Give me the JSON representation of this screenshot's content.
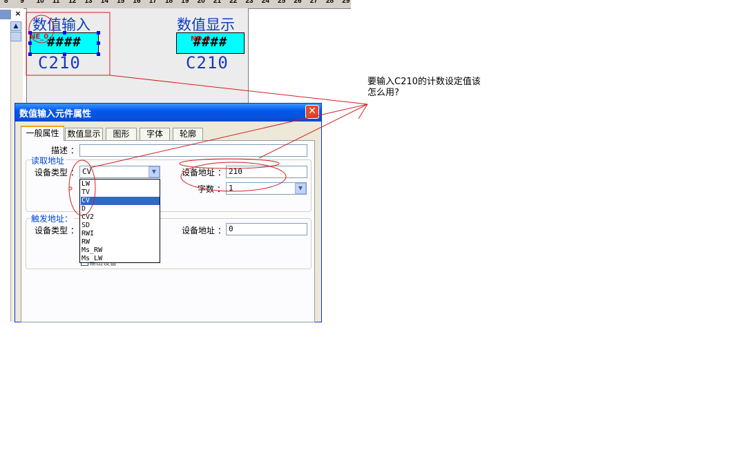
{
  "ruler": {
    "ticks": [
      "8",
      "9",
      "10",
      "11",
      "12",
      "13",
      "14",
      "15",
      "16",
      "17",
      "18",
      "19",
      "20",
      "21",
      "22",
      "23",
      "24",
      "25",
      "26",
      "27",
      "28",
      "29"
    ]
  },
  "panel": {
    "close_label": "×",
    "scroll_up": "▲"
  },
  "canvas": {
    "num_input": {
      "title": "数值输入",
      "tag": "NE_0",
      "mask": "####",
      "address": "C210"
    },
    "num_display": {
      "title": "数值显示",
      "tag": "ND_0",
      "mask": "####",
      "address": "C210"
    }
  },
  "dialog": {
    "title": "数值输入元件属性",
    "close_label": "✕",
    "tabs": [
      "一般属性",
      "数值显示",
      "图形",
      "字体",
      "轮廓"
    ],
    "general": {
      "desc_label": "描述 ：",
      "desc_value": "",
      "read_group": "读取地址",
      "read_device_type_label": "设备类型 ：",
      "read_device_type_value": "CV",
      "read_device_addr_label": "设备地址 ：",
      "read_device_addr_value": "210",
      "word_count_label": "字数 ：",
      "word_count_value": "1",
      "trigger_group": "触发地址：",
      "trig_device_type_label": "设备类型 ：",
      "trig_device_addr_label": "设备地址 ：",
      "trig_device_addr_value": "0",
      "hidden_checkbox_label": "输出设备"
    },
    "dropdown_options": [
      "LW",
      "TV",
      "CV",
      "D",
      "CV2",
      "SD",
      "RWI",
      "RW",
      "Ms_RW",
      "Ms_LW"
    ],
    "selected_option": "CV"
  },
  "annotation": {
    "text": "要输入C210的计数设定值该怎么用?"
  },
  "colors": {
    "accent_red": "#d21e1e",
    "canvas_text": "#1537c8",
    "box_fill": "#00ffff",
    "title_blue": "#0058ee"
  }
}
